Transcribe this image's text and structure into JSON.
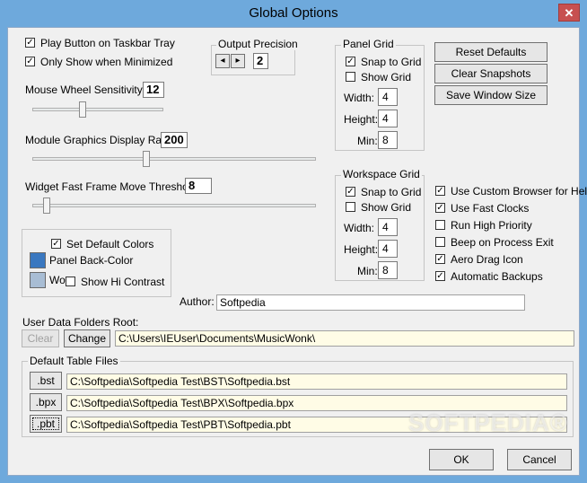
{
  "window": {
    "title": "Global Options",
    "close_glyph": "✕"
  },
  "taskbar": {
    "play_button": {
      "label": "Play Button on Taskbar Tray",
      "checked": true
    },
    "only_show": {
      "label": "Only Show  when Minimized",
      "checked": true
    }
  },
  "output_precision": {
    "title": "Output Precision",
    "value": "2",
    "left_glyph": "◂",
    "right_glyph": "▸"
  },
  "panel_grid": {
    "title": "Panel Grid",
    "snap": {
      "label": "Snap to Grid",
      "checked": true
    },
    "show": {
      "label": "Show Grid",
      "checked": false
    },
    "width_label": "Width:",
    "width": "4",
    "height_label": "Height:",
    "height": "4",
    "min_label": "Min:",
    "min": "8"
  },
  "workspace_grid": {
    "title": "Workspace Grid",
    "snap": {
      "label": "Snap to Grid",
      "checked": true
    },
    "show": {
      "label": "Show Grid",
      "checked": false
    },
    "width_label": "Width:",
    "width": "4",
    "height_label": "Height:",
    "height": "4",
    "min_label": "Min:",
    "min": "8"
  },
  "buttons": {
    "reset_defaults": "Reset Defaults",
    "clear_snapshots": "Clear Snapshots",
    "save_window_size": "Save Window Size",
    "ok": "OK",
    "cancel": "Cancel"
  },
  "sliders": {
    "mouse_wheel": {
      "label": "Mouse Wheel Sensitivity:",
      "value": "12",
      "level": 0.38
    },
    "graphics_rate": {
      "label": "Module Graphics Display Rate:",
      "value": "200",
      "level": 0.4
    },
    "fast_frame": {
      "label": "Widget Fast Frame Move Threshold:",
      "value": "8",
      "level": 0.04
    }
  },
  "colors": {
    "set_default": {
      "label": "Set Default Colors",
      "checked": true
    },
    "panel_back": {
      "label": "Panel Back-Color",
      "color": "#3a78c0"
    },
    "wo": {
      "label": "Wo",
      "color": "#a8bdd4"
    },
    "hi_contrast": {
      "label": "Show Hi Contrast",
      "checked": false
    }
  },
  "options": [
    {
      "label": "Use Custom Browser for Help",
      "checked": true
    },
    {
      "label": "Use Fast Clocks",
      "checked": true
    },
    {
      "label": "Run High Priority",
      "checked": false
    },
    {
      "label": "Beep on Process Exit",
      "checked": false
    },
    {
      "label": "Aero Drag Icon",
      "checked": true
    },
    {
      "label": "Automatic Backups",
      "checked": true
    }
  ],
  "author": {
    "label": "Author:",
    "value": "Softpedia"
  },
  "user_data": {
    "label": "User Data Folders Root:",
    "clear": "Clear",
    "change": "Change",
    "path": "C:\\Users\\IEUser\\Documents\\MusicWonk\\"
  },
  "table_files": {
    "title": "Default Table Files",
    "bst": {
      "button": ".bst",
      "path": "C:\\Softpedia\\Softpedia Test\\BST\\Softpedia.bst"
    },
    "bpx": {
      "button": ".bpx",
      "path": "C:\\Softpedia\\Softpedia Test\\BPX\\Softpedia.bpx"
    },
    "pbt": {
      "button": ".pbt",
      "path": "C:\\Softpedia\\Softpedia Test\\PBT\\Softpedia.pbt"
    }
  },
  "watermark": "SOFTPEDIA®"
}
